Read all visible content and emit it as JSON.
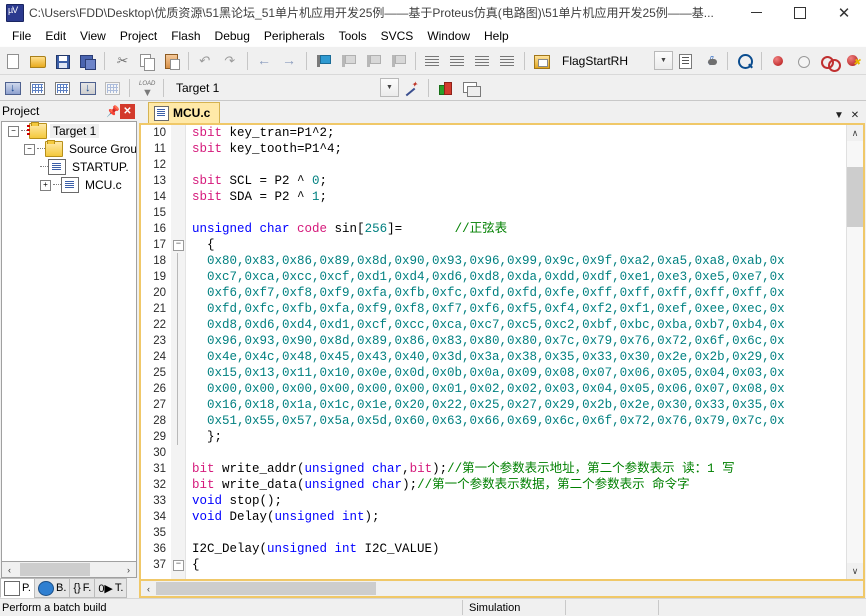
{
  "window": {
    "title": "C:\\Users\\FDD\\Desktop\\优质资源\\51黑论坛_51单片机应用开发25例——基于Proteus仿真(电路图)\\51单片机应用开发25例——基...",
    "app_icon": "keil-uvision-icon",
    "minimize": "–",
    "maximize": "□",
    "close": "✕"
  },
  "menu": {
    "items": [
      "File",
      "Edit",
      "View",
      "Project",
      "Flash",
      "Debug",
      "Peripherals",
      "Tools",
      "SVCS",
      "Window",
      "Help"
    ]
  },
  "toolbar_main": {
    "flag_label": "FlagStartRH",
    "icons": [
      "new-file-icon",
      "open-file-icon",
      "save-icon",
      "save-all-icon",
      "cut-icon",
      "copy-icon",
      "paste-icon",
      "undo-icon",
      "redo-icon",
      "navigate-back-icon",
      "navigate-forward-icon",
      "toggle-bookmark-icon",
      "prev-bookmark-icon",
      "next-bookmark-icon",
      "clear-bookmarks-icon",
      "indent-icon",
      "outdent-icon",
      "comment-icon",
      "uncomment-icon",
      "find-in-files-icon",
      "insert-bookmark-combo-icon",
      "debug-window-icon",
      "start-debug-icon",
      "find-icon",
      "insert-breakpoint-icon",
      "disable-breakpoint-icon",
      "disable-all-breakpoints-icon",
      "kill-all-breakpoints-icon"
    ]
  },
  "toolbar_build": {
    "target_value": "Target 1",
    "icons": [
      "translate-icon",
      "build-icon",
      "rebuild-icon",
      "batch-build-icon",
      "stop-build-icon",
      "download-icon",
      "target-options-icon",
      "manage-components-icon",
      "multi-project-icon"
    ]
  },
  "project_pane": {
    "title": "Project",
    "pin_icon": "pin-icon",
    "close_icon": "close-icon",
    "tree": [
      {
        "label": "Target 1",
        "icon": "target-folder-icon",
        "expander": "-",
        "depth": 0,
        "selected": true
      },
      {
        "label": "Source Group",
        "icon": "source-folder-icon",
        "expander": "-",
        "depth": 1,
        "selected": false
      },
      {
        "label": "STARTUP.",
        "icon": "file-icon",
        "expander": "",
        "depth": 2,
        "selected": false
      },
      {
        "label": "MCU.c",
        "icon": "file-icon",
        "expander": "+",
        "depth": 2,
        "selected": false
      }
    ],
    "tabs": [
      {
        "label": "P.",
        "icon": "project-icon",
        "active": false
      },
      {
        "label": "B.",
        "icon": "books-icon",
        "active": true
      },
      {
        "label": "F.",
        "icon": "functions-icon",
        "active": false
      },
      {
        "label": "T.",
        "icon": "templates-icon",
        "active": false
      }
    ],
    "hscroll_left": "‹",
    "hscroll_right": "›"
  },
  "editor": {
    "tab_label": "MCU.c",
    "tab_icon": "c-file-icon",
    "tab_menu_icon": "chevron-down-icon",
    "tab_close_icon": "close-icon",
    "scroll_up": "∧",
    "scroll_down": "∨",
    "hscroll_left": "‹",
    "first_line_number": 10,
    "lines": [
      {
        "n": 10,
        "fold": "",
        "tokens": [
          {
            "t": "sbit",
            "c": "kw"
          },
          {
            "t": " key_tran=P1^2;",
            "c": "plain"
          }
        ]
      },
      {
        "n": 11,
        "fold": "",
        "tokens": [
          {
            "t": "sbit",
            "c": "kw"
          },
          {
            "t": " key_tooth=P1^4;",
            "c": "plain"
          }
        ]
      },
      {
        "n": 12,
        "fold": "",
        "tokens": []
      },
      {
        "n": 13,
        "fold": "",
        "tokens": [
          {
            "t": "sbit",
            "c": "kw"
          },
          {
            "t": " SCL = P2 ^ ",
            "c": "plain"
          },
          {
            "t": "0",
            "c": "num"
          },
          {
            "t": ";",
            "c": "plain"
          }
        ]
      },
      {
        "n": 14,
        "fold": "",
        "tokens": [
          {
            "t": "sbit",
            "c": "kw"
          },
          {
            "t": " SDA = P2 ^ ",
            "c": "plain"
          },
          {
            "t": "1",
            "c": "num"
          },
          {
            "t": ";",
            "c": "plain"
          }
        ]
      },
      {
        "n": 15,
        "fold": "",
        "tokens": []
      },
      {
        "n": 16,
        "fold": "",
        "tokens": [
          {
            "t": "unsigned char ",
            "c": "kw2"
          },
          {
            "t": "code",
            "c": "kw"
          },
          {
            "t": " sin[",
            "c": "plain"
          },
          {
            "t": "256",
            "c": "num"
          },
          {
            "t": "]=       ",
            "c": "plain"
          },
          {
            "t": "//正弦表",
            "c": "cmt"
          }
        ]
      },
      {
        "n": 17,
        "fold": "-",
        "tokens": [
          {
            "t": "  {",
            "c": "plain"
          }
        ]
      },
      {
        "n": 18,
        "fold": "|",
        "tokens": [
          {
            "t": "  0x80,0x83,0x86,0x89,0x8d,0x90,0x93,0x96,0x99,0x9c,0x9f,0xa2,0xa5,0xa8,0xab,0x",
            "c": "num"
          }
        ]
      },
      {
        "n": 19,
        "fold": "|",
        "tokens": [
          {
            "t": "  0xc7,0xca,0xcc,0xcf,0xd1,0xd4,0xd6,0xd8,0xda,0xdd,0xdf,0xe1,0xe3,0xe5,0xe7,0x",
            "c": "num"
          }
        ]
      },
      {
        "n": 20,
        "fold": "|",
        "tokens": [
          {
            "t": "  0xf6,0xf7,0xf8,0xf9,0xfa,0xfb,0xfc,0xfd,0xfd,0xfe,0xff,0xff,0xff,0xff,0xff,0x",
            "c": "num"
          }
        ]
      },
      {
        "n": 21,
        "fold": "|",
        "tokens": [
          {
            "t": "  0xfd,0xfc,0xfb,0xfa,0xf9,0xf8,0xf7,0xf6,0xf5,0xf4,0xf2,0xf1,0xef,0xee,0xec,0x",
            "c": "num"
          }
        ]
      },
      {
        "n": 22,
        "fold": "|",
        "tokens": [
          {
            "t": "  0xd8,0xd6,0xd4,0xd1,0xcf,0xcc,0xca,0xc7,0xc5,0xc2,0xbf,0xbc,0xba,0xb7,0xb4,0x",
            "c": "num"
          }
        ]
      },
      {
        "n": 23,
        "fold": "|",
        "tokens": [
          {
            "t": "  0x96,0x93,0x90,0x8d,0x89,0x86,0x83,0x80,0x80,0x7c,0x79,0x76,0x72,0x6f,0x6c,0x",
            "c": "num"
          }
        ]
      },
      {
        "n": 24,
        "fold": "|",
        "tokens": [
          {
            "t": "  0x4e,0x4c,0x48,0x45,0x43,0x40,0x3d,0x3a,0x38,0x35,0x33,0x30,0x2e,0x2b,0x29,0x",
            "c": "num"
          }
        ]
      },
      {
        "n": 25,
        "fold": "|",
        "tokens": [
          {
            "t": "  0x15,0x13,0x11,0x10,0x0e,0x0d,0x0b,0x0a,0x09,0x08,0x07,0x06,0x05,0x04,0x03,0x",
            "c": "num"
          }
        ]
      },
      {
        "n": 26,
        "fold": "|",
        "tokens": [
          {
            "t": "  0x00,0x00,0x00,0x00,0x00,0x00,0x01,0x02,0x02,0x03,0x04,0x05,0x06,0x07,0x08,0x",
            "c": "num"
          }
        ]
      },
      {
        "n": 27,
        "fold": "|",
        "tokens": [
          {
            "t": "  0x16,0x18,0x1a,0x1c,0x1e,0x20,0x22,0x25,0x27,0x29,0x2b,0x2e,0x30,0x33,0x35,0x",
            "c": "num"
          }
        ]
      },
      {
        "n": 28,
        "fold": "|",
        "tokens": [
          {
            "t": "  0x51,0x55,0x57,0x5a,0x5d,0x60,0x63,0x66,0x69,0x6c,0x6f,0x72,0x76,0x79,0x7c,0x",
            "c": "num"
          }
        ]
      },
      {
        "n": 29,
        "fold": "|",
        "tokens": [
          {
            "t": "  };",
            "c": "plain"
          }
        ]
      },
      {
        "n": 30,
        "fold": "",
        "tokens": []
      },
      {
        "n": 31,
        "fold": "",
        "tokens": [
          {
            "t": "bit",
            "c": "kw"
          },
          {
            "t": " write_addr(",
            "c": "plain"
          },
          {
            "t": "unsigned char",
            "c": "kw2"
          },
          {
            "t": ",",
            "c": "plain"
          },
          {
            "t": "bit",
            "c": "kw"
          },
          {
            "t": ");",
            "c": "plain"
          },
          {
            "t": "//第一个参数表示地址，第二个参数表示 读：1 写",
            "c": "cmt"
          }
        ]
      },
      {
        "n": 32,
        "fold": "",
        "tokens": [
          {
            "t": "bit",
            "c": "kw"
          },
          {
            "t": " write_data(",
            "c": "plain"
          },
          {
            "t": "unsigned char",
            "c": "kw2"
          },
          {
            "t": ");",
            "c": "plain"
          },
          {
            "t": "//第一个参数表示数据，第二个参数表示 命令字",
            "c": "cmt"
          }
        ]
      },
      {
        "n": 33,
        "fold": "",
        "tokens": [
          {
            "t": "void",
            "c": "kw2"
          },
          {
            "t": " stop();",
            "c": "plain"
          }
        ]
      },
      {
        "n": 34,
        "fold": "",
        "tokens": [
          {
            "t": "void",
            "c": "kw2"
          },
          {
            "t": " Delay(",
            "c": "plain"
          },
          {
            "t": "unsigned int",
            "c": "kw2"
          },
          {
            "t": ");",
            "c": "plain"
          }
        ]
      },
      {
        "n": 35,
        "fold": "",
        "tokens": []
      },
      {
        "n": 36,
        "fold": "",
        "tokens": [
          {
            "t": "I2C_Delay(",
            "c": "plain"
          },
          {
            "t": "unsigned int",
            "c": "kw2"
          },
          {
            "t": " I2C_VALUE)",
            "c": "plain"
          }
        ]
      },
      {
        "n": 37,
        "fold": "-",
        "tokens": [
          {
            "t": "{",
            "c": "plain"
          }
        ]
      }
    ]
  },
  "statusbar": {
    "message": "Perform a batch build",
    "cells": [
      "",
      "Simulation",
      "",
      ""
    ]
  },
  "colors": {
    "keyword_pink": "#d5197b",
    "keyword_blue": "#0000ff",
    "number_teal": "#008080",
    "comment_green": "#008000",
    "tab_active": "#ffe9a8",
    "editor_border": "#f0c868",
    "close_red": "#d33a2c"
  }
}
